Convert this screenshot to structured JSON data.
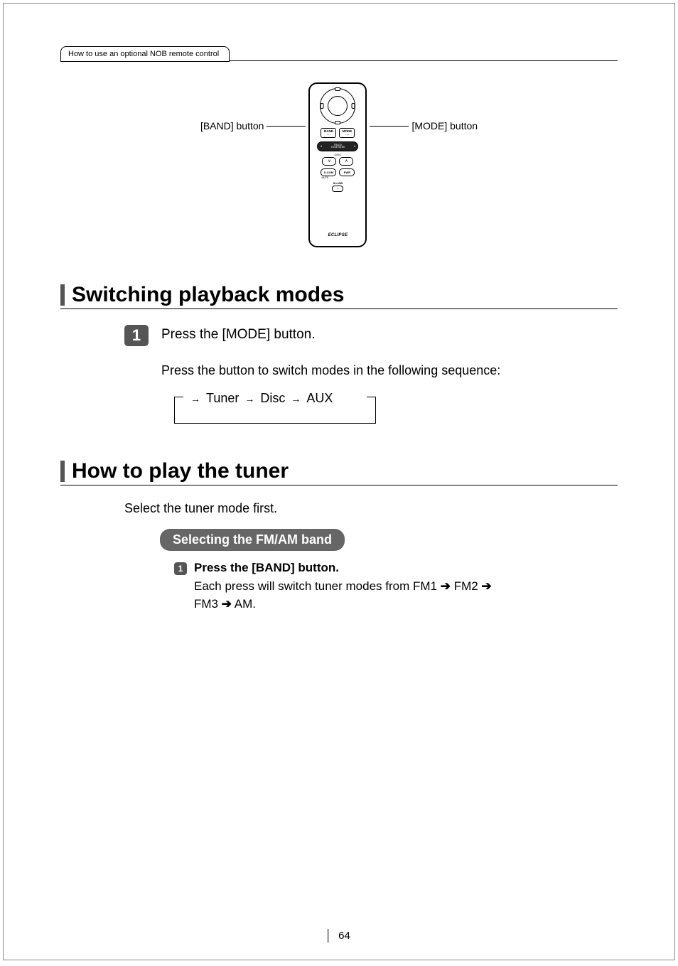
{
  "breadcrumb": "How to use an optional NOB remote control",
  "diagram": {
    "left_label": "[BAND] button",
    "right_label": "[MODE] button",
    "remote": {
      "band": "BAND",
      "mode": "MODE",
      "pill_left": "∨",
      "pill_center": "TRACK\nTUNE SEEK",
      "pill_right": "∧",
      "disc_label": "DISC",
      "down": "∨",
      "up": "∧",
      "scom": "S-COM",
      "pwr": "PWR",
      "mute": "MUTE",
      "illumi": "ILLUMI",
      "logo": "ECLIPSE"
    }
  },
  "section1": {
    "title": "Switching playback modes",
    "step_num": "1",
    "step_text": "Press the [MODE] button.",
    "body": "Press the button to switch modes in the following sequence:",
    "seq": {
      "a": "Tuner",
      "b": "Disc",
      "c": "AUX"
    }
  },
  "section2": {
    "title": "How to play the tuner",
    "intro": "Select the tuner mode first.",
    "pill": "Selecting the FM/AM band",
    "sub_num": "1",
    "sub_bold": "Press the [BAND] button.",
    "sub_desc_a": "Each press will switch tuner modes from FM1 ",
    "sub_desc_b": " FM2 ",
    "sub_desc_c": " FM3 ",
    "sub_desc_d": " AM.",
    "arrow": "➔"
  },
  "page_number": "64"
}
